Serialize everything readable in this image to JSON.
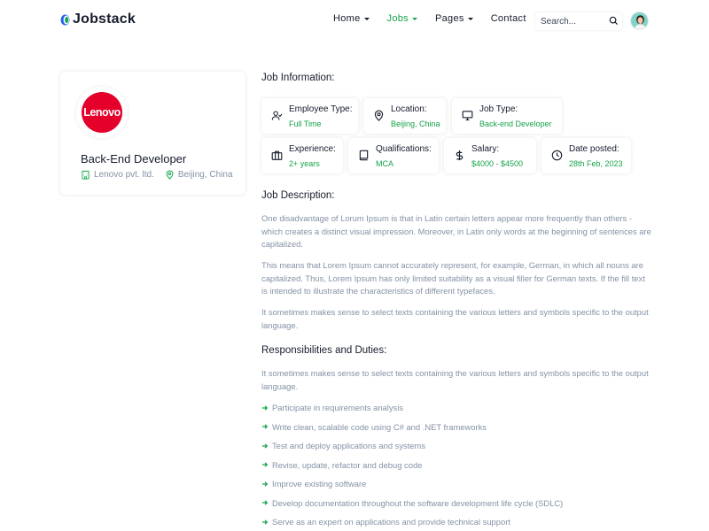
{
  "brand": {
    "name": "Jobstack"
  },
  "nav": {
    "items": [
      {
        "label": "Home"
      },
      {
        "label": "Jobs"
      },
      {
        "label": "Pages"
      },
      {
        "label": "Contact"
      }
    ],
    "search_placeholder": "Search..."
  },
  "company_card": {
    "logo_text": "Lenovo",
    "job_title": "Back-End Developer",
    "company": "Lenovo pvt. ltd.",
    "location": "Beijing, China"
  },
  "job_info": {
    "heading": "Job Information:",
    "items": [
      {
        "label": "Employee Type:",
        "value": "Full Time",
        "icon": "user-check-icon"
      },
      {
        "label": "Location:",
        "value": "Beijing, China",
        "icon": "map-pin-icon"
      },
      {
        "label": "Job Type:",
        "value": "Back-end Developer",
        "icon": "monitor-icon"
      },
      {
        "label": "Experience:",
        "value": "2+ years",
        "icon": "briefcase-icon"
      },
      {
        "label": "Qualifications:",
        "value": "MCA",
        "icon": "book-icon"
      },
      {
        "label": "Salary:",
        "value": "$4000 - $4500",
        "icon": "dollar-icon"
      },
      {
        "label": "Date posted:",
        "value": "28th Feb, 2023",
        "icon": "clock-icon"
      }
    ]
  },
  "description": {
    "heading": "Job Description:",
    "paragraphs": [
      "One disadvantage of Lorum Ipsum is that in Latin certain letters appear more frequently than others - which creates a distinct visual impression. Moreover, in Latin only words at the beginning of sentences are capitalized.",
      "This means that Lorem Ipsum cannot accurately represent, for example, German, in which all nouns are capitalized. Thus, Lorem Ipsum has only limited suitability as a visual filler for German texts. If the fill text is intended to illustrate the characteristics of different typefaces.",
      "It sometimes makes sense to select texts containing the various letters and symbols specific to the output language."
    ]
  },
  "responsibilities": {
    "heading": "Responsibilities and Duties:",
    "intro": "It sometimes makes sense to select texts containing the various letters and symbols specific to the output language.",
    "items": [
      "Participate in requirements analysis",
      "Write clean, scalable code using C# and .NET frameworks",
      "Test and deploy applications and systems",
      "Revise, update, refactor and debug code",
      "Improve existing software",
      "Develop documentation throughout the software development life cycle (SDLC)",
      "Serve as an expert on applications and provide technical support"
    ]
  },
  "colors": {
    "accent": "#16a34a",
    "muted": "#8492a6",
    "text": "#161c2d",
    "lenovo": "#e4002b"
  }
}
